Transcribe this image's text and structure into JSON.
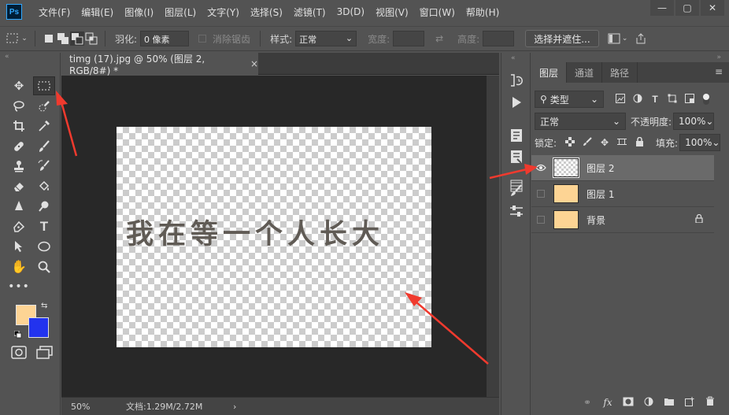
{
  "app": {
    "logo": "Ps",
    "menu": [
      "文件(F)",
      "编辑(E)",
      "图像(I)",
      "图层(L)",
      "文字(Y)",
      "选择(S)",
      "滤镜(T)",
      "3D(D)",
      "视图(V)",
      "窗口(W)",
      "帮助(H)"
    ],
    "window_controls": [
      "—",
      "▢",
      "✕"
    ]
  },
  "options_bar": {
    "feather_label": "羽化:",
    "feather_value": "0 像素",
    "antialias_label": "消除锯齿",
    "style_label": "样式:",
    "style_value": "正常",
    "width_label": "宽度:",
    "height_label": "高度:",
    "select_mask_button": "选择并遮住..."
  },
  "document": {
    "tab_title": "timg (17).jpg @ 50% (图层 2, RGB/8#) *",
    "tab_close": "×",
    "canvas_text": "我在等一个人长大",
    "status_zoom": "50%",
    "status_doc": "文档:1.29M/2.72M",
    "status_arrow": "›"
  },
  "colors": {
    "foreground": "#fdd494",
    "background": "#2233ee",
    "canvas_text": "#605b55",
    "annotation": "#f03a2e"
  },
  "layers_panel": {
    "tabs": [
      "图层",
      "通道",
      "路径"
    ],
    "filter_label": "类型",
    "blend_mode": "正常",
    "opacity_label": "不透明度:",
    "opacity_value": "100%",
    "lock_label": "锁定:",
    "fill_label": "填充:",
    "fill_value": "100%",
    "layers": [
      {
        "name": "图层 2",
        "visible": true,
        "selected": true,
        "thumb": "transparent"
      },
      {
        "name": "图层 1",
        "visible": false,
        "selected": false,
        "thumb": "fill"
      },
      {
        "name": "背景",
        "visible": false,
        "selected": false,
        "thumb": "fill",
        "locked": true
      }
    ],
    "bottom_icons": [
      "link-icon",
      "fx-icon",
      "mask-icon",
      "adjustment-icon",
      "folder-icon",
      "new-layer-icon",
      "trash-icon"
    ]
  }
}
